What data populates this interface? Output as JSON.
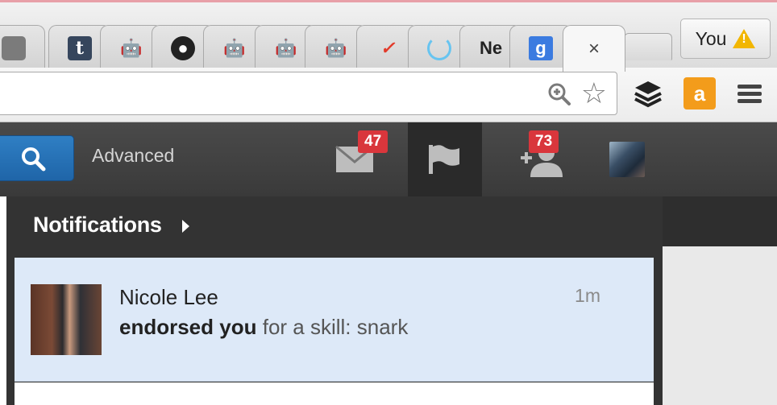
{
  "browser": {
    "tabs": [
      {
        "icon": "apple-icon",
        "glyph": ""
      },
      {
        "icon": "tumblr-icon",
        "glyph": "t"
      },
      {
        "icon": "android-icon",
        "glyph": "🤖"
      },
      {
        "icon": "github-icon",
        "glyph": "●"
      },
      {
        "icon": "android-icon",
        "glyph": "🤖"
      },
      {
        "icon": "android-icon",
        "glyph": "🤖"
      },
      {
        "icon": "android-icon",
        "glyph": "🤖"
      },
      {
        "icon": "nike-icon",
        "glyph": "✓"
      },
      {
        "icon": "power-icon",
        "glyph": "|"
      },
      {
        "icon": "text-favicon",
        "glyph": "Ne"
      },
      {
        "icon": "google-icon",
        "glyph": "g"
      }
    ],
    "active_tab_close": "×",
    "profile_label": "You"
  },
  "linkedin": {
    "advanced_label": "Advanced",
    "messages_count": "47",
    "invitations_count": "73"
  },
  "notifications": {
    "title": "Notifications",
    "items": [
      {
        "name": "Nicole Lee",
        "action": "endorsed you",
        "detail": "for a skill: snark",
        "time": "1m"
      }
    ]
  },
  "colors": {
    "search_button": "#2a75bb",
    "badge": "#d9363c",
    "notification_bg": "#dde9f8",
    "header_bg": "#404040"
  }
}
